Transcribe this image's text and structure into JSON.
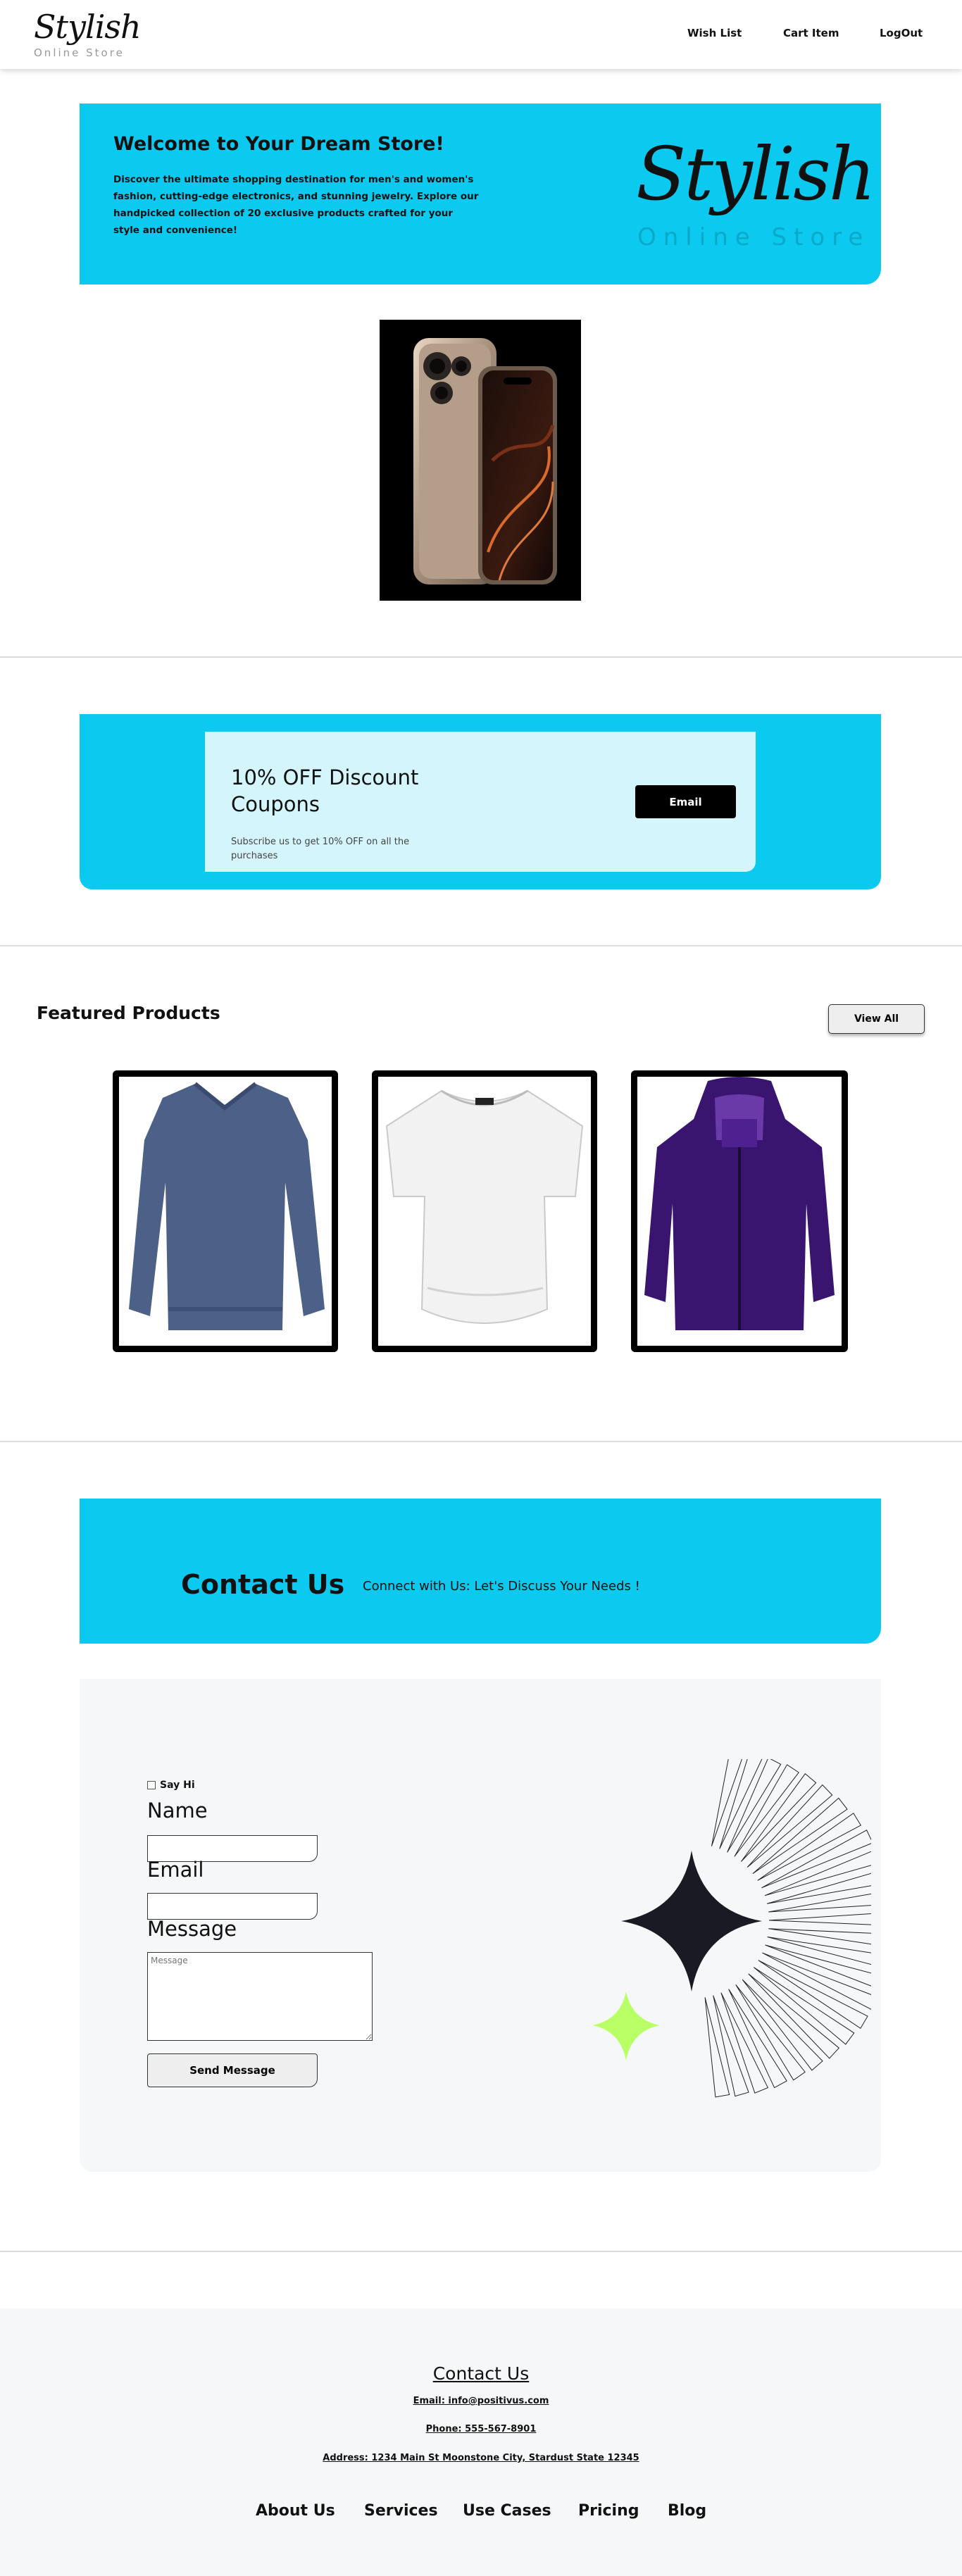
{
  "nav": {
    "logo": "Stylish",
    "logo_sub": "Online Store",
    "links": [
      "Wish List",
      "Cart Item",
      "LogOut"
    ]
  },
  "hero": {
    "title": "Welcome to Your Dream Store!",
    "text": "Discover the ultimate shopping destination for men's and women's fashion, cutting-edge electronics, and stunning jewelry. Explore our handpicked collection of 20 exclusive products crafted for your style and convenience!",
    "logo": "Stylish",
    "logo_sub": "Online Store"
  },
  "coupon": {
    "title": "10% OFF Discount Coupons",
    "subtitle": "Subscribe us to get 10% OFF on all the purchases",
    "button": "Email"
  },
  "featured": {
    "title": "Featured Products",
    "view_all": "View All"
  },
  "contact": {
    "title": "Contact Us",
    "subtitle": "Connect with Us: Let's Discuss Your Needs !",
    "say_hi": "Say Hi",
    "name_label": "Name",
    "email_label": "Email",
    "message_label": "Message",
    "message_placeholder": "Message",
    "send": "Send Message"
  },
  "footer": {
    "contact_title": "Contact Us",
    "email": "Email: info@positivus.com",
    "phone": "Phone: 555-567-8901",
    "address": "Address: 1234 Main St Moonstone City, Stardust State 12345",
    "links": [
      "About Us",
      "Services",
      "Use Cases",
      "Pricing",
      "Blog"
    ]
  },
  "colors": {
    "accent": "#0cc9f0",
    "coupon_inner": "#d3f5fb",
    "form_bg": "#f6f7f8",
    "star_dark": "#191a23",
    "star_green": "#b9ff66"
  }
}
